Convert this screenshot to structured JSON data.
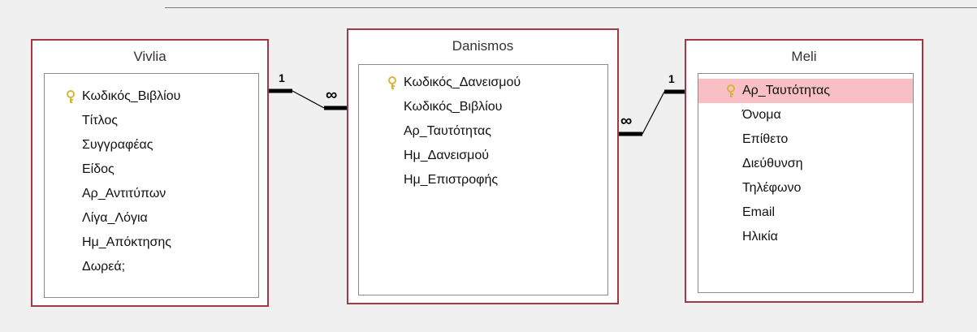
{
  "tables": [
    {
      "name": "Vivlia",
      "fields": [
        {
          "label": "Κωδικός_Βιβλίου",
          "key": true
        },
        {
          "label": "Τίτλος"
        },
        {
          "label": "Συγγραφέας"
        },
        {
          "label": "Είδος"
        },
        {
          "label": "Αρ_Αντιτύπων"
        },
        {
          "label": "Λίγα_Λόγια"
        },
        {
          "label": "Ημ_Απόκτησης"
        },
        {
          "label": "Δωρεά;"
        }
      ]
    },
    {
      "name": "Danismos",
      "fields": [
        {
          "label": "Κωδικός_Δανεισμού",
          "key": true
        },
        {
          "label": "Κωδικός_Βιβλίου"
        },
        {
          "label": "Αρ_Ταυτότητας"
        },
        {
          "label": "Ημ_Δανεισμού"
        },
        {
          "label": "Ημ_Επιστροφής"
        }
      ]
    },
    {
      "name": "Meli",
      "fields": [
        {
          "label": "Αρ_Ταυτότητας",
          "key": true,
          "selected": true
        },
        {
          "label": "Όνομα"
        },
        {
          "label": "Επίθετο"
        },
        {
          "label": "Διεύθυνση"
        },
        {
          "label": "Τηλέφωνο"
        },
        {
          "label": "Email"
        },
        {
          "label": "Ηλικία"
        }
      ]
    }
  ],
  "relationships": [
    {
      "one_label": "1",
      "many_label": "∞"
    },
    {
      "one_label": "1",
      "many_label": "∞"
    }
  ],
  "colors": {
    "table_border": "#a33842",
    "selected_field": "#f8c0c4",
    "background": "#f0f0f0",
    "key_icon": "#d8b53a"
  },
  "icons": {
    "primary_key": "key-icon"
  }
}
